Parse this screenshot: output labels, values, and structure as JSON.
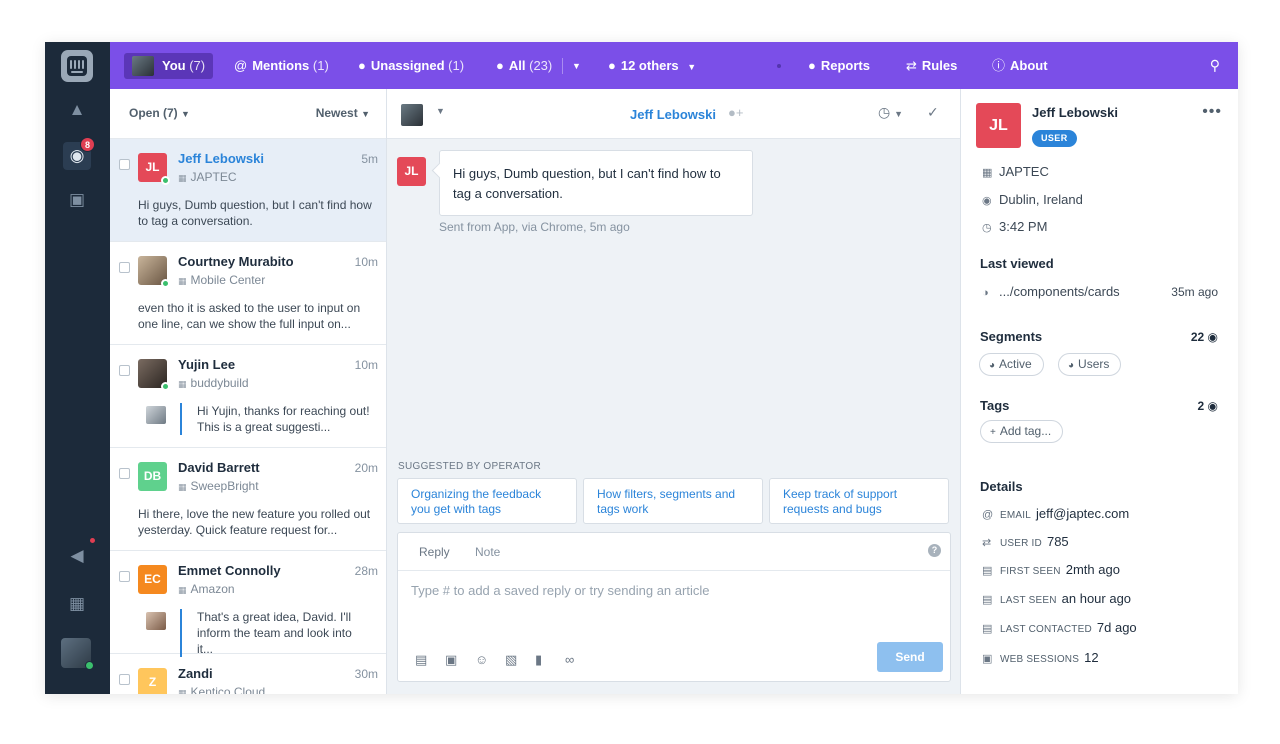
{
  "topbar": {
    "you": {
      "label": "You",
      "count": "(7)"
    },
    "mentions": {
      "label": "Mentions",
      "count": "(1)"
    },
    "unassigned": {
      "label": "Unassigned",
      "count": "(1)"
    },
    "all": {
      "label": "All",
      "count": "(23)"
    },
    "others": {
      "label": "12 others"
    },
    "reports": {
      "label": "Reports"
    },
    "rules": {
      "label": "Rules"
    },
    "about": {
      "label": "About"
    }
  },
  "rail": {
    "notification_count": "8"
  },
  "list": {
    "filter_label": "Open (7)",
    "sort_label": "Newest",
    "conversations": [
      {
        "initials": "JL",
        "avatar_color": "#e44958",
        "name": "Jeff Lebowski",
        "time": "5m",
        "company": "JAPTEC",
        "message": "Hi guys, Dumb question, but I can't find how to tag a conversation."
      },
      {
        "name": "Courtney Murabito",
        "time": "10m",
        "company": "Mobile Center",
        "message": "even tho it is asked to the user to input on one line, can we show the full input on..."
      },
      {
        "name": "Yujin Lee",
        "time": "10m",
        "company": "buddybuild",
        "reply": "Hi Yujin, thanks for reaching out! This is a great suggesti..."
      },
      {
        "initials": "DB",
        "avatar_color": "#5fd18d",
        "name": "David Barrett",
        "time": "20m",
        "company": "SweepBright",
        "message": "Hi there, love the new feature you rolled out yesterday. Quick feature request for..."
      },
      {
        "initials": "EC",
        "avatar_color": "#f5891f",
        "name": "Emmet Connolly",
        "time": "28m",
        "company": "Amazon",
        "reply": "That's a great idea, David. I'll inform the team and look into it..."
      },
      {
        "initials": "Z",
        "avatar_color": "#ffc65c",
        "name": "Zandi",
        "time": "30m",
        "company": "Kentico Cloud"
      }
    ]
  },
  "conversation": {
    "customer_name": "Jeff Lebowski",
    "message_initials": "JL",
    "message": "Hi guys, Dumb question, but I can't find how to tag a conversation.",
    "meta": "Sent from App, via Chrome, 5m ago",
    "suggested_title": "SUGGESTED BY OPERATOR",
    "suggestions": [
      "Organizing the feedback you get with tags",
      "How filters, segments and tags work",
      "Keep track of support requests and bugs"
    ],
    "composer": {
      "tab_reply": "Reply",
      "tab_note": "Note",
      "help": "?",
      "placeholder": "Type # to add a saved reply or try sending an article",
      "send_label": "Send"
    }
  },
  "profile": {
    "initials": "JL",
    "name": "Jeff Lebowski",
    "role_badge": "USER",
    "company": "JAPTEC",
    "location": "Dublin, Ireland",
    "local_time": "3:42 PM",
    "last_viewed_title": "Last viewed",
    "last_viewed_page": ".../components/cards",
    "last_viewed_time": "35m ago",
    "segments_title": "Segments",
    "segments_count": "22",
    "segments": [
      "Active",
      "Users"
    ],
    "tags_title": "Tags",
    "tags_count": "2",
    "add_tag_label": "Add tag...",
    "details_title": "Details",
    "details": [
      {
        "label": "EMAIL",
        "value": "jeff@japtec.com"
      },
      {
        "label": "USER ID",
        "value": "785"
      },
      {
        "label": "FIRST SEEN",
        "value": "2mth ago"
      },
      {
        "label": "LAST SEEN",
        "value": "an hour ago"
      },
      {
        "label": "LAST CONTACTED",
        "value": "7d ago"
      },
      {
        "label": "WEB SESSIONS",
        "value": "12"
      }
    ]
  },
  "colors": {
    "accent": "#7b4fe8",
    "rail": "#1c2a3a",
    "link": "#2b84d9",
    "jl_red": "#e44958"
  }
}
